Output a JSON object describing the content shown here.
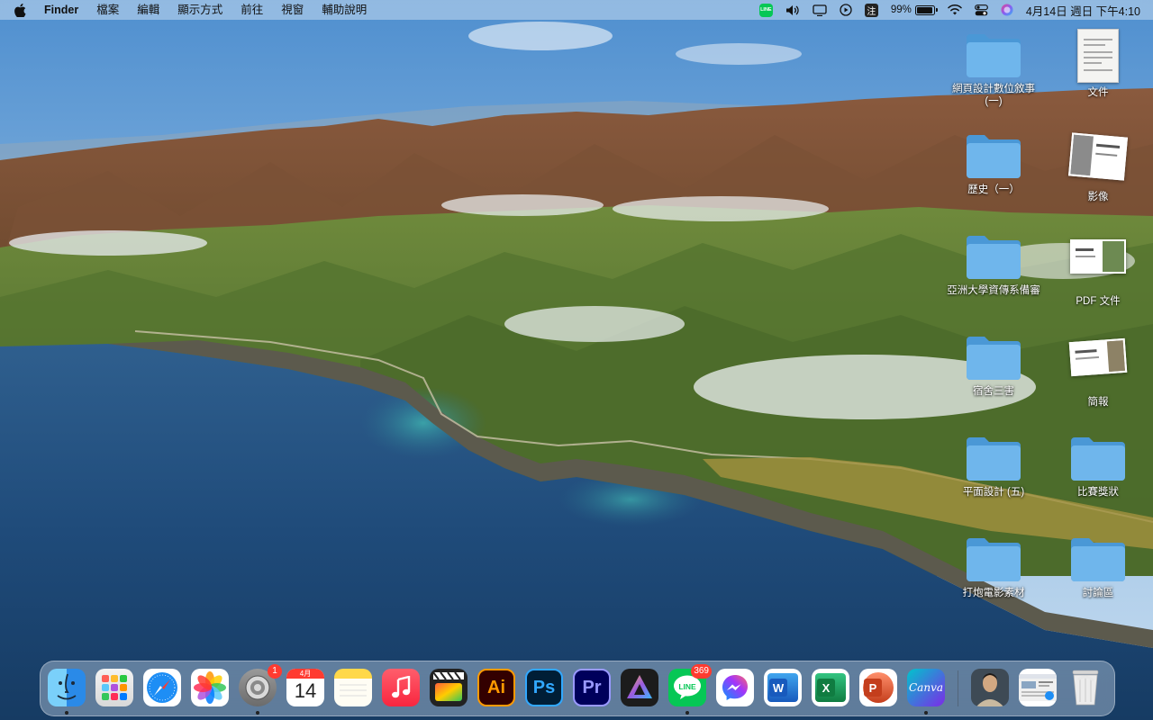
{
  "menubar": {
    "apple_icon": "apple-logo-icon",
    "app_name": "Finder",
    "menus": [
      "檔案",
      "編輯",
      "顯示方式",
      "前往",
      "視窗",
      "輔助說明"
    ],
    "status": {
      "line_label": "LINE",
      "ime_label": "注",
      "battery_percent": "99%",
      "battery_level": 0.99,
      "datetime": "4月14日 週日 下午4:10"
    }
  },
  "desktop": {
    "items": [
      {
        "label": "網頁設計數位敘事(一)",
        "kind": "folder"
      },
      {
        "label": "文件",
        "kind": "document"
      },
      {
        "label": "歷史（一）",
        "kind": "folder"
      },
      {
        "label": "影像",
        "kind": "image"
      },
      {
        "label": "亞洲大學資傳系備審",
        "kind": "folder"
      },
      {
        "label": "PDF 文件",
        "kind": "image"
      },
      {
        "label": "宿舍三害",
        "kind": "folder"
      },
      {
        "label": "簡報",
        "kind": "image"
      },
      {
        "label": "平面設計 (五)",
        "kind": "folder"
      },
      {
        "label": "比賽獎狀",
        "kind": "folder"
      },
      {
        "label": "打炮電影素材",
        "kind": "folder"
      },
      {
        "label": "討論區",
        "kind": "folder"
      }
    ]
  },
  "dock": {
    "apps": [
      {
        "name": "finder",
        "icon": "finder-icon",
        "running": true
      },
      {
        "name": "launchpad",
        "icon": "launchpad-icon",
        "running": false
      },
      {
        "name": "safari",
        "icon": "safari-icon",
        "running": false
      },
      {
        "name": "photos",
        "icon": "photos-icon",
        "running": false
      },
      {
        "name": "system-preferences",
        "icon": "gear-icon",
        "running": true,
        "badge": "1"
      },
      {
        "name": "calendar",
        "icon": "calendar-icon",
        "running": false,
        "month": "4月",
        "day": "14"
      },
      {
        "name": "notes",
        "icon": "notes-icon",
        "running": true
      },
      {
        "name": "music",
        "icon": "music-icon",
        "running": false
      },
      {
        "name": "final-cut-pro",
        "icon": "final-cut-pro-icon",
        "running": false
      },
      {
        "name": "illustrator",
        "icon": "illustrator-icon",
        "running": false,
        "text": "Ai"
      },
      {
        "name": "photoshop",
        "icon": "photoshop-icon",
        "running": false,
        "text": "Ps"
      },
      {
        "name": "premiere-pro",
        "icon": "premiere-pro-icon",
        "running": false,
        "text": "Pr"
      },
      {
        "name": "davinci",
        "icon": "davinci-icon",
        "running": false
      },
      {
        "name": "line",
        "icon": "line-icon",
        "running": true,
        "badge": "369",
        "text": "LINE"
      },
      {
        "name": "messenger",
        "icon": "messenger-icon",
        "running": false
      },
      {
        "name": "word",
        "icon": "word-icon",
        "running": false,
        "text": "W"
      },
      {
        "name": "excel",
        "icon": "excel-icon",
        "running": false,
        "text": "X"
      },
      {
        "name": "powerpoint",
        "icon": "powerpoint-icon",
        "running": false,
        "text": "P"
      },
      {
        "name": "canva",
        "icon": "canva-icon",
        "running": true,
        "text": "Canva"
      }
    ],
    "stacks": [
      "portrait-stack",
      "screenshot-stack"
    ],
    "trash_icon": "trash-icon"
  },
  "colors": {
    "folder": "#6fb6ec",
    "folder_dark": "#4a98d6",
    "dock_badge": "#ff3b30"
  }
}
